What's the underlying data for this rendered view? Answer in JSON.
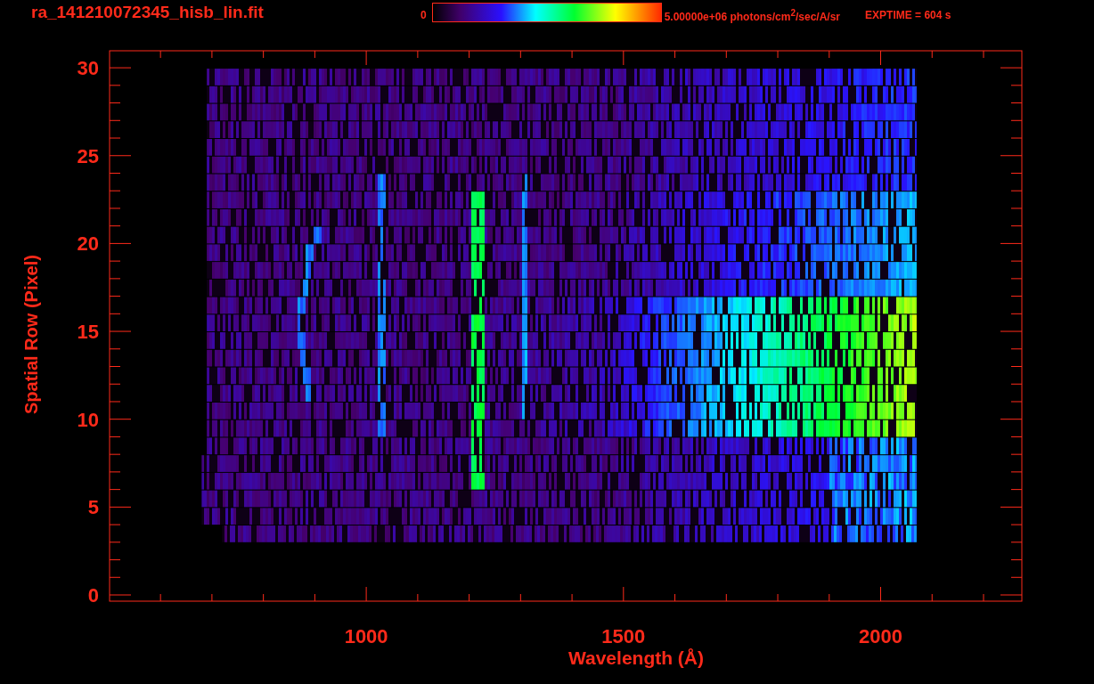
{
  "header": {
    "filename": "ra_141210072345_hisb_lin.fit",
    "colorbar": {
      "min_label": "0",
      "max_label": "5.00000e+06 photons/cm$^{2}$/sec/A/sr"
    },
    "exposure": "EXPTIME = 604 s"
  },
  "plot": {
    "ylabel": "Spatial Row (Pixel)",
    "xlabel": "Wavelength (Å)",
    "yticks": [
      "30",
      "25",
      "20",
      "15",
      "10",
      "5",
      "0"
    ],
    "xticks": [
      "1000",
      "1500",
      "2000"
    ]
  }
}
